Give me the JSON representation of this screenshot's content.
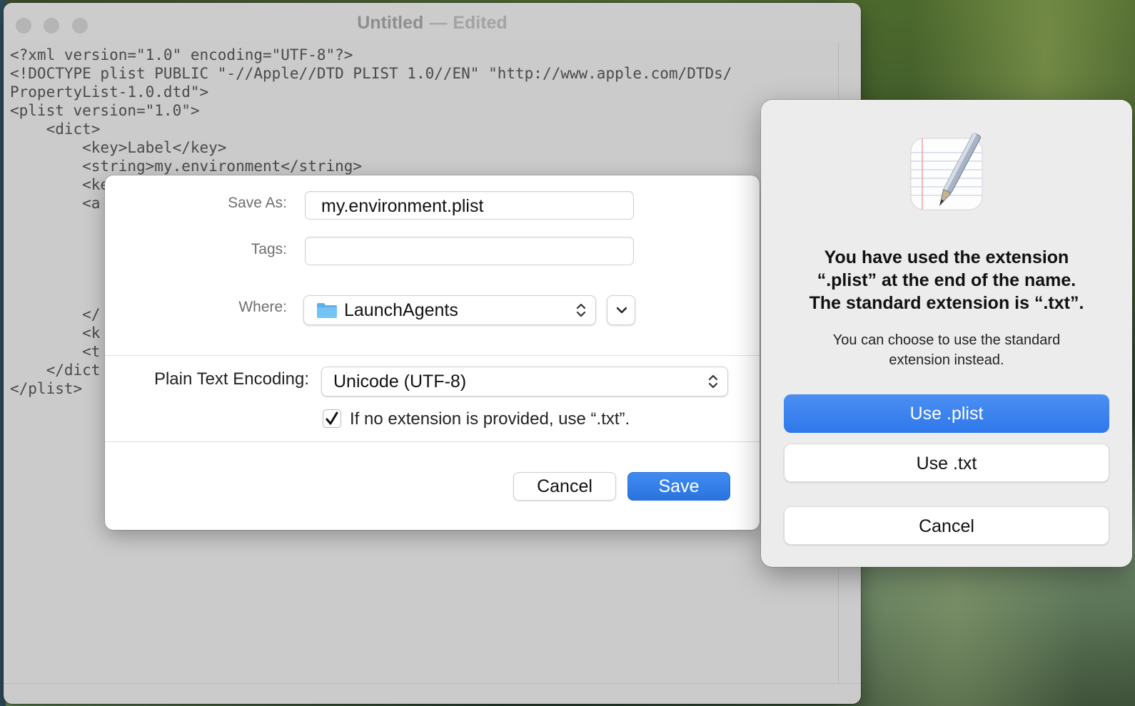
{
  "window": {
    "title": "Untitled",
    "separator": "—",
    "status": "Edited"
  },
  "document": {
    "lines": [
      "<?xml version=\"1.0\" encoding=\"UTF-8\"?>",
      "<!DOCTYPE plist PUBLIC \"-//Apple//DTD PLIST 1.0//EN\" \"http://www.apple.com/DTDs/",
      "PropertyList-1.0.dtd\">",
      "<plist version=\"1.0\">",
      "    <dict>",
      "        <key>Label</key>",
      "        <string>my.environment</string>",
      "        <ke",
      "        <a",
      "",
      "",
      "",
      "",
      "",
      "        </",
      "        <k",
      "        <t",
      "    </dict",
      "</plist>"
    ]
  },
  "save_sheet": {
    "save_as_label": "Save As:",
    "save_as_value": "my.environment.plist",
    "tags_label": "Tags:",
    "tags_value": "",
    "where_label": "Where:",
    "where_value": "LaunchAgents",
    "encoding_label": "Plain Text Encoding:",
    "encoding_value": "Unicode (UTF-8)",
    "checkbox_label": "If no extension is provided, use “.txt”.",
    "checkbox_checked": true,
    "cancel_label": "Cancel",
    "save_label": "Save"
  },
  "alert": {
    "title": "You have used the extension\n“.plist” at the end of the name.\nThe standard extension is “.txt”.",
    "message": "You can choose to use the standard\nextension instead.",
    "use_plist_label": "Use .plist",
    "use_txt_label": "Use .txt",
    "cancel_label": "Cancel",
    "icon": "textedit-app-icon"
  }
}
